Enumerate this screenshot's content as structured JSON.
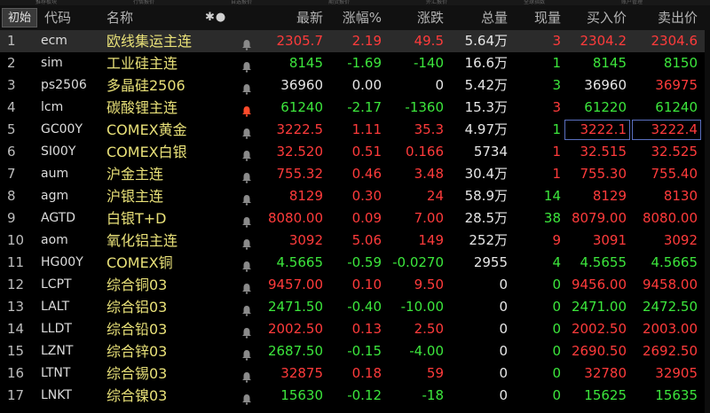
{
  "tabs": [
    "推荐板块",
    "行情报价",
    "自选报价",
    "期货报价",
    "外汇报价",
    "全球指数",
    "账户管理"
  ],
  "header": {
    "init_btn": "初始",
    "code": "代码",
    "name": "名称",
    "config_icon": "✱●",
    "latest": "最新",
    "pct": "涨幅%",
    "change": "涨跌",
    "volume": "总量",
    "current": "现量",
    "bid": "买入价",
    "ask": "卖出价"
  },
  "colors": {
    "up": "#ff3b3b",
    "down": "#3ce63c",
    "name": "#e8e078",
    "bell_active": "#ff4b2b",
    "bell_idle": "#8a8a8a"
  },
  "rows": [
    {
      "idx": "1",
      "code": "ecm",
      "name": "欧线集运主连",
      "bell": "idle",
      "latest": "2305.7",
      "pct": "2.19",
      "change": "49.5",
      "volume": "5.64万",
      "current": "3",
      "bid": "2304.2",
      "ask": "2304.6",
      "price_dir": "up",
      "chg_dir": "up",
      "cur_dir": "up",
      "bid_dir": "up",
      "ask_dir": "up",
      "selected": true
    },
    {
      "idx": "2",
      "code": "sim",
      "name": "工业硅主连",
      "bell": "idle",
      "latest": "8145",
      "pct": "-1.69",
      "change": "-140",
      "volume": "16.6万",
      "current": "1",
      "bid": "8145",
      "ask": "8150",
      "price_dir": "dn",
      "chg_dir": "dn",
      "cur_dir": "dn",
      "bid_dir": "dn",
      "ask_dir": "dn"
    },
    {
      "idx": "3",
      "code": "ps2506",
      "name": "多晶硅2506",
      "bell": "idle",
      "latest": "36960",
      "pct": "0.00",
      "change": "0",
      "volume": "5.42万",
      "current": "3",
      "bid": "36960",
      "ask": "36975",
      "price_dir": "flat",
      "chg_dir": "flat",
      "cur_dir": "dn",
      "bid_dir": "flat",
      "ask_dir": "up"
    },
    {
      "idx": "4",
      "code": "lcm",
      "name": "碳酸锂主连",
      "bell": "active",
      "latest": "61240",
      "pct": "-2.17",
      "change": "-1360",
      "volume": "15.3万",
      "current": "3",
      "bid": "61220",
      "ask": "61240",
      "price_dir": "dn",
      "chg_dir": "dn",
      "cur_dir": "up",
      "bid_dir": "dn",
      "ask_dir": "dn"
    },
    {
      "idx": "5",
      "code": "GC00Y",
      "name": "COMEX黄金",
      "bell": "idle",
      "latest": "3222.5",
      "pct": "1.11",
      "change": "35.3",
      "volume": "4.97万",
      "current": "1",
      "bid": "3222.1",
      "ask": "3222.4",
      "price_dir": "up",
      "chg_dir": "up",
      "cur_dir": "dn",
      "bid_dir": "up",
      "ask_dir": "up",
      "boxed": true
    },
    {
      "idx": "6",
      "code": "SI00Y",
      "name": "COMEX白银",
      "bell": "idle",
      "latest": "32.520",
      "pct": "0.51",
      "change": "0.166",
      "volume": "5734",
      "current": "1",
      "bid": "32.515",
      "ask": "32.525",
      "price_dir": "up",
      "chg_dir": "up",
      "cur_dir": "up",
      "bid_dir": "up",
      "ask_dir": "up"
    },
    {
      "idx": "7",
      "code": "aum",
      "name": "沪金主连",
      "bell": "idle",
      "latest": "755.32",
      "pct": "0.46",
      "change": "3.48",
      "volume": "30.4万",
      "current": "1",
      "bid": "755.30",
      "ask": "755.40",
      "price_dir": "up",
      "chg_dir": "up",
      "cur_dir": "up",
      "bid_dir": "up",
      "ask_dir": "up"
    },
    {
      "idx": "8",
      "code": "agm",
      "name": "沪银主连",
      "bell": "idle",
      "latest": "8129",
      "pct": "0.30",
      "change": "24",
      "volume": "58.9万",
      "current": "14",
      "bid": "8129",
      "ask": "8130",
      "price_dir": "up",
      "chg_dir": "up",
      "cur_dir": "dn",
      "bid_dir": "up",
      "ask_dir": "up"
    },
    {
      "idx": "9",
      "code": "AGTD",
      "name": "白银T+D",
      "bell": "idle",
      "latest": "8080.00",
      "pct": "0.09",
      "change": "7.00",
      "volume": "28.5万",
      "current": "38",
      "bid": "8079.00",
      "ask": "8080.00",
      "price_dir": "up",
      "chg_dir": "up",
      "cur_dir": "dn",
      "bid_dir": "up",
      "ask_dir": "up"
    },
    {
      "idx": "10",
      "code": "aom",
      "name": "氧化铝主连",
      "bell": "idle",
      "latest": "3092",
      "pct": "5.06",
      "change": "149",
      "volume": "252万",
      "current": "9",
      "bid": "3091",
      "ask": "3092",
      "price_dir": "up",
      "chg_dir": "up",
      "cur_dir": "up",
      "bid_dir": "up",
      "ask_dir": "up"
    },
    {
      "idx": "11",
      "code": "HG00Y",
      "name": "COMEX铜",
      "bell": "idle",
      "latest": "4.5665",
      "pct": "-0.59",
      "change": "-0.0270",
      "volume": "2955",
      "current": "4",
      "bid": "4.5655",
      "ask": "4.5665",
      "price_dir": "dn",
      "chg_dir": "dn",
      "cur_dir": "dn",
      "bid_dir": "dn",
      "ask_dir": "dn"
    },
    {
      "idx": "12",
      "code": "LCPT",
      "name": "综合铜03",
      "bell": "idle",
      "latest": "9457.00",
      "pct": "0.10",
      "change": "9.50",
      "volume": "0",
      "current": "0",
      "bid": "9456.00",
      "ask": "9458.00",
      "price_dir": "up",
      "chg_dir": "up",
      "cur_dir": "dn",
      "bid_dir": "up",
      "ask_dir": "up"
    },
    {
      "idx": "13",
      "code": "LALT",
      "name": "综合铝03",
      "bell": "idle",
      "latest": "2471.50",
      "pct": "-0.40",
      "change": "-10.00",
      "volume": "0",
      "current": "0",
      "bid": "2471.00",
      "ask": "2472.50",
      "price_dir": "dn",
      "chg_dir": "dn",
      "cur_dir": "dn",
      "bid_dir": "dn",
      "ask_dir": "dn"
    },
    {
      "idx": "14",
      "code": "LLDT",
      "name": "综合铅03",
      "bell": "idle",
      "latest": "2002.50",
      "pct": "0.13",
      "change": "2.50",
      "volume": "0",
      "current": "0",
      "bid": "2002.50",
      "ask": "2003.00",
      "price_dir": "up",
      "chg_dir": "up",
      "cur_dir": "dn",
      "bid_dir": "up",
      "ask_dir": "up"
    },
    {
      "idx": "15",
      "code": "LZNT",
      "name": "综合锌03",
      "bell": "idle",
      "latest": "2687.50",
      "pct": "-0.15",
      "change": "-4.00",
      "volume": "0",
      "current": "0",
      "bid": "2690.50",
      "ask": "2692.50",
      "price_dir": "dn",
      "chg_dir": "dn",
      "cur_dir": "dn",
      "bid_dir": "up",
      "ask_dir": "up"
    },
    {
      "idx": "16",
      "code": "LTNT",
      "name": "综合锡03",
      "bell": "idle",
      "latest": "32875",
      "pct": "0.18",
      "change": "59",
      "volume": "0",
      "current": "0",
      "bid": "32780",
      "ask": "32905",
      "price_dir": "up",
      "chg_dir": "up",
      "cur_dir": "dn",
      "bid_dir": "up",
      "ask_dir": "up"
    },
    {
      "idx": "17",
      "code": "LNKT",
      "name": "综合镍03",
      "bell": "idle",
      "latest": "15630",
      "pct": "-0.12",
      "change": "-18",
      "volume": "0",
      "current": "0",
      "bid": "15625",
      "ask": "15635",
      "price_dir": "dn",
      "chg_dir": "dn",
      "cur_dir": "dn",
      "bid_dir": "dn",
      "ask_dir": "dn"
    }
  ]
}
